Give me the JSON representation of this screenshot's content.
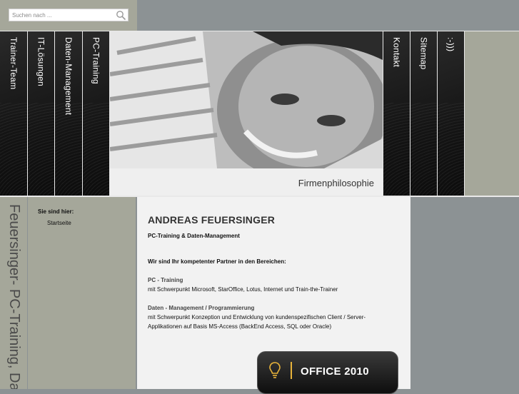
{
  "search": {
    "placeholder": "Suchen nach ..."
  },
  "nav": {
    "left": [
      "Trainer-Team",
      "IT-Lösungen",
      "Daten-Management",
      "PC-Training"
    ],
    "right": [
      "Kontakt",
      "Sitemap",
      ":-)))"
    ]
  },
  "hero": {
    "caption": "Firmenphilosophie"
  },
  "sidebar": {
    "title": "Feuersinger- PC-Training, Daten"
  },
  "breadcrumb": {
    "label": "Sie sind hier:",
    "link": "Startseite"
  },
  "content": {
    "heading": "ANDREAS FEUERSINGER",
    "subheading": "PC-Training & Daten-Management",
    "intro": "Wir sind Ihr kompetenter Partner in den Bereichen:",
    "section1_title": "PC - Training",
    "section1_text": "mit Schwerpunkt Microsoft, StarOffice, Lotus, Internet und Train-the-Trainer",
    "section2_title": "Daten - Management / Programmierung",
    "section2_line1": "mit Schwerpunkt Konzeption und Entwicklung von kundenspezifischen Client / Server-",
    "section2_line2": "Applikationen auf Basis MS-Access (BackEnd Access, SQL oder Oracle)"
  },
  "badge": {
    "label": "OFFICE 2010"
  },
  "colors": {
    "panel": "#a5a79a",
    "background": "#8c9294",
    "content": "#f2f2f2",
    "accent": "#e8b33a"
  }
}
